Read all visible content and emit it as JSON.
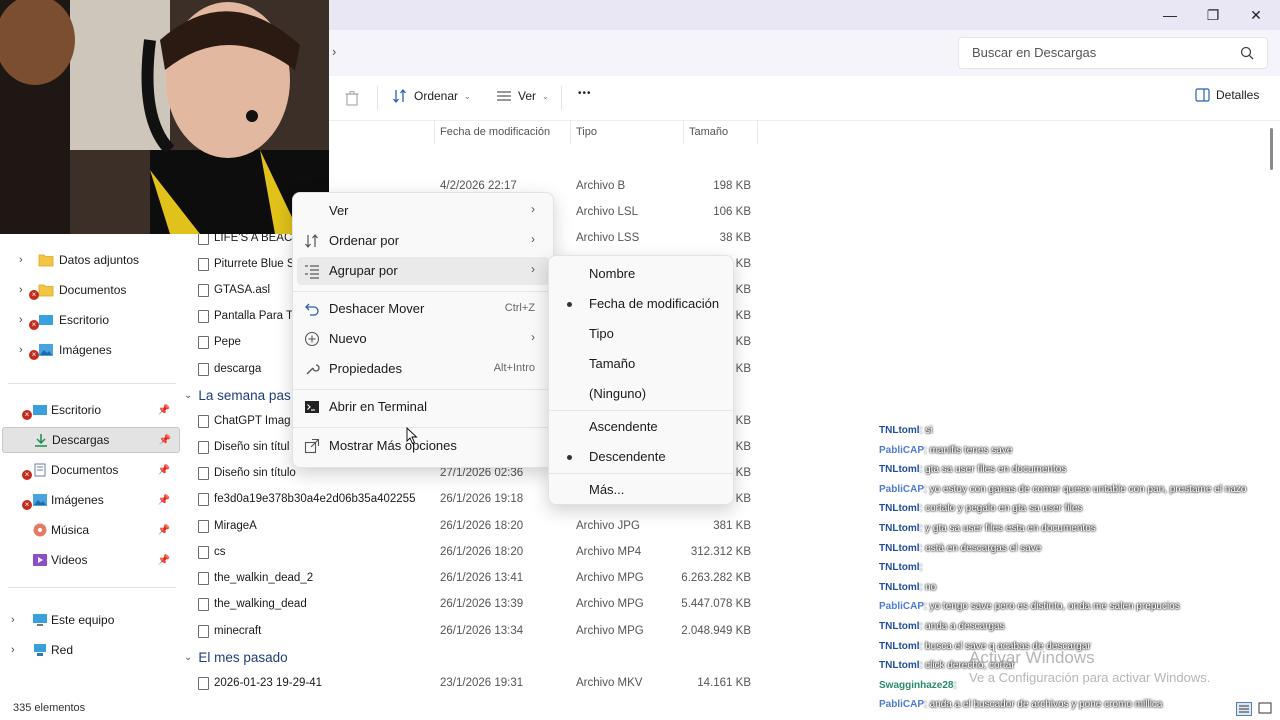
{
  "window": {
    "minimize": "—",
    "maximize": "❐",
    "close": "✕"
  },
  "address": {
    "chevron": "›",
    "search_placeholder": "Buscar en Descargas"
  },
  "toolbar": {
    "sort_label": "Ordenar",
    "view_label": "Ver",
    "more_label": "•••",
    "details_label": "Detalles"
  },
  "columns": {
    "modified": "Fecha de modificación",
    "type": "Tipo",
    "size": "Tamaño"
  },
  "sidebar": {
    "items": [
      {
        "label": "Datos adjuntos"
      },
      {
        "label": "Documentos"
      },
      {
        "label": "Escritorio"
      },
      {
        "label": "Imágenes"
      },
      {
        "label": "Escritorio"
      },
      {
        "label": "Descargas"
      },
      {
        "label": "Documentos"
      },
      {
        "label": "Imágenes"
      },
      {
        "label": "Música"
      },
      {
        "label": "Videos"
      },
      {
        "label": "Este equipo"
      },
      {
        "label": "Red"
      }
    ]
  },
  "files": [
    {
      "name": "",
      "date": "4/2/2026 22:17",
      "type": "Archivo B",
      "size": "198 KB"
    },
    {
      "name": "",
      "date": "",
      "type": "Archivo LSL",
      "size": "106 KB"
    },
    {
      "name": "LIFE'S A BEACH",
      "date": "",
      "type": "Archivo LSS",
      "size": "38 KB"
    },
    {
      "name": "Piturrete Blue S",
      "date": "",
      "type": "",
      "size": "7 KB"
    },
    {
      "name": "GTASA.asl",
      "date": "",
      "type": "",
      "size": "2 KB"
    },
    {
      "name": "Pantalla Para T",
      "date": "",
      "type": "",
      "size": "5 KB"
    },
    {
      "name": "Pepe",
      "date": "",
      "type": "",
      "size": "3 KB"
    },
    {
      "name": "descarga",
      "date": "",
      "type": "",
      "size": "6 KB"
    },
    {
      "name": "ChatGPT Imag",
      "date": "",
      "type": "",
      "size": "KB"
    },
    {
      "name": "Diseño sin títul",
      "date": "",
      "type": "",
      "size": "2 KB"
    },
    {
      "name": "Diseño sin título",
      "date": "27/1/2026 02:36",
      "type": "",
      "size": "KB"
    },
    {
      "name": "fe3d0a19e378b30a4e2d06b35a402255",
      "date": "26/1/2026 19:18",
      "type": "",
      "size": "4 KB"
    },
    {
      "name": "MirageA",
      "date": "26/1/2026 18:20",
      "type": "Archivo JPG",
      "size": "381 KB"
    },
    {
      "name": "cs",
      "date": "26/1/2026 18:20",
      "type": "Archivo MP4",
      "size": "312.312 KB"
    },
    {
      "name": "the_walkin_dead_2",
      "date": "26/1/2026 13:41",
      "type": "Archivo MPG",
      "size": "6.263.282 KB"
    },
    {
      "name": "the_walking_dead",
      "date": "26/1/2026 13:39",
      "type": "Archivo MPG",
      "size": "5.447.078 KB"
    },
    {
      "name": "minecraft",
      "date": "26/1/2026 13:34",
      "type": "Archivo MPG",
      "size": "2.048.949 KB"
    },
    {
      "name": "2026-01-23 19-29-41",
      "date": "23/1/2026 19:31",
      "type": "Archivo MKV",
      "size": "14.161 KB"
    }
  ],
  "groups": {
    "last_week": "La semana pas",
    "last_month": "El mes pasado"
  },
  "status": {
    "count": "335 elementos"
  },
  "context_menu": {
    "items": [
      {
        "label": "Ver",
        "shortcut": "",
        "arrow": "›"
      },
      {
        "label": "Ordenar por",
        "shortcut": "",
        "arrow": "›"
      },
      {
        "label": "Agrupar por",
        "shortcut": "",
        "arrow": "›"
      },
      {
        "label": "Deshacer Mover",
        "shortcut": "Ctrl+Z",
        "arrow": ""
      },
      {
        "label": "Nuevo",
        "shortcut": "",
        "arrow": "›"
      },
      {
        "label": "Propiedades",
        "shortcut": "Alt+Intro",
        "arrow": ""
      },
      {
        "label": "Abrir en Terminal",
        "shortcut": "",
        "arrow": ""
      },
      {
        "label": "Mostrar Más opciones",
        "shortcut": "",
        "arrow": ""
      }
    ]
  },
  "submenu": {
    "items": [
      {
        "label": "Nombre"
      },
      {
        "label": "Fecha de modificación"
      },
      {
        "label": "Tipo"
      },
      {
        "label": "Tamaño"
      },
      {
        "label": "(Ninguno)"
      },
      {
        "label": "Ascendente"
      },
      {
        "label": "Descendente"
      },
      {
        "label": "Más..."
      }
    ]
  },
  "chat": {
    "lines": [
      {
        "user": "TNLtoml",
        "msg": ": si"
      },
      {
        "user": "PabliCAP",
        "msg": ": manifis tenes save"
      },
      {
        "user": "TNLtoml",
        "msg": ": gta sa user files en documentos"
      },
      {
        "user": "PabliCAP",
        "msg": ": yo estoy con ganas de comer queso untable con pan, prestame el nazo"
      },
      {
        "user": "TNLtoml",
        "msg": ": cortalo y pegalo en gta sa user files"
      },
      {
        "user": "TNLtoml",
        "msg": ": y gta sa user files esta en documentos"
      },
      {
        "user": "TNLtoml",
        "msg": ": está en descargas el save"
      },
      {
        "user": "TNLtoml",
        "msg": ":"
      },
      {
        "user": "TNLtoml",
        "msg": ": no"
      },
      {
        "user": "PabliCAP",
        "msg": ": yo tengo save pero es distinto, onda me salen prepucios"
      },
      {
        "user": "TNLtoml",
        "msg": ": anda a descargas"
      },
      {
        "user": "TNLtoml",
        "msg": ": busca el save q acabas de descargar"
      },
      {
        "user": "TNLtoml",
        "msg": ": click derecho, cortar"
      },
      {
        "user": "Swagginhaze28",
        "msg": ":"
      },
      {
        "user": "PabliCAP",
        "msg": ": anda a el buscador de archivos y pone cromo millica"
      }
    ]
  },
  "watermark": {
    "title": "Activar Windows",
    "subtitle": "Ve a Configuración para activar Windows."
  }
}
